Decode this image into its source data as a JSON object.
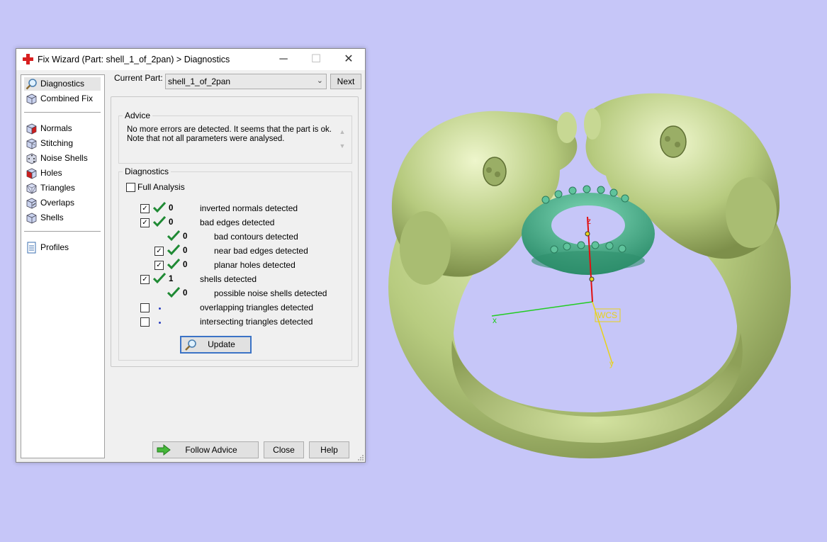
{
  "window": {
    "title": "Fix Wizard (Part: shell_1_of_2pan) > Diagnostics",
    "minimize_glyph": "─",
    "maximize_glyph": "☐",
    "close_glyph": "✕"
  },
  "sidebar": {
    "items": [
      {
        "label": "Diagnostics",
        "icon": "magnifier-icon",
        "selected": true
      },
      {
        "label": "Combined Fix",
        "icon": "cube-icon"
      },
      {
        "label": "Normals",
        "icon": "cube-red-face-icon"
      },
      {
        "label": "Stitching",
        "icon": "cube-stitching-icon"
      },
      {
        "label": "Noise Shells",
        "icon": "cube-dice-icon"
      },
      {
        "label": "Holes",
        "icon": "cube-red-hole-icon"
      },
      {
        "label": "Triangles",
        "icon": "cube-wire-icon"
      },
      {
        "label": "Overlaps",
        "icon": "cube-overlap-icon"
      },
      {
        "label": "Shells",
        "icon": "cube-shells-icon"
      },
      {
        "label": "Profiles",
        "icon": "document-icon"
      }
    ]
  },
  "header": {
    "current_part_label": "Current Part:",
    "current_part_value": "shell_1_of_2pan",
    "next_label": "Next"
  },
  "advice": {
    "title": "Advice",
    "line1": "No more errors are detected. It seems that the part is ok.",
    "line2": "Note that not all parameters were analysed."
  },
  "diagnostics": {
    "title": "Diagnostics",
    "full_analysis_label": "Full Analysis",
    "full_analysis_checked": false,
    "rows": [
      {
        "label": "inverted normals detected",
        "count": "0",
        "checked": true,
        "status": "check",
        "level": 0
      },
      {
        "label": "bad edges detected",
        "count": "0",
        "checked": true,
        "status": "check",
        "level": 0
      },
      {
        "label": "bad contours detected",
        "count": "0",
        "checked": null,
        "status": "check",
        "level": 1
      },
      {
        "label": "near bad edges detected",
        "count": "0",
        "checked": true,
        "status": "check",
        "level": 1
      },
      {
        "label": "planar holes detected",
        "count": "0",
        "checked": true,
        "status": "check",
        "level": 1
      },
      {
        "label": "shells detected",
        "count": "1",
        "checked": true,
        "status": "check",
        "level": 0
      },
      {
        "label": "possible noise shells detected",
        "count": "0",
        "checked": null,
        "status": "check",
        "level": 1
      },
      {
        "label": "overlapping triangles detected",
        "count": "",
        "checked": false,
        "status": "dot",
        "level": 0
      },
      {
        "label": "intersecting triangles detected",
        "count": "",
        "checked": false,
        "status": "dot",
        "level": 0
      }
    ],
    "update_label": "Update"
  },
  "footer": {
    "follow_advice_label": "Follow Advice",
    "close_label": "Close",
    "help_label": "Help"
  },
  "viewport": {
    "axis_x_label": "x",
    "axis_y_label": "y",
    "axis_z_label": "z",
    "wcs_label": "WCS",
    "colors": {
      "background": "#c6c6f8",
      "ring": "#b8cc80",
      "stone_setting": "#3fae8a",
      "axis_x": "#22cc22",
      "axis_y": "#e8d21a",
      "axis_z": "#e01010"
    }
  }
}
